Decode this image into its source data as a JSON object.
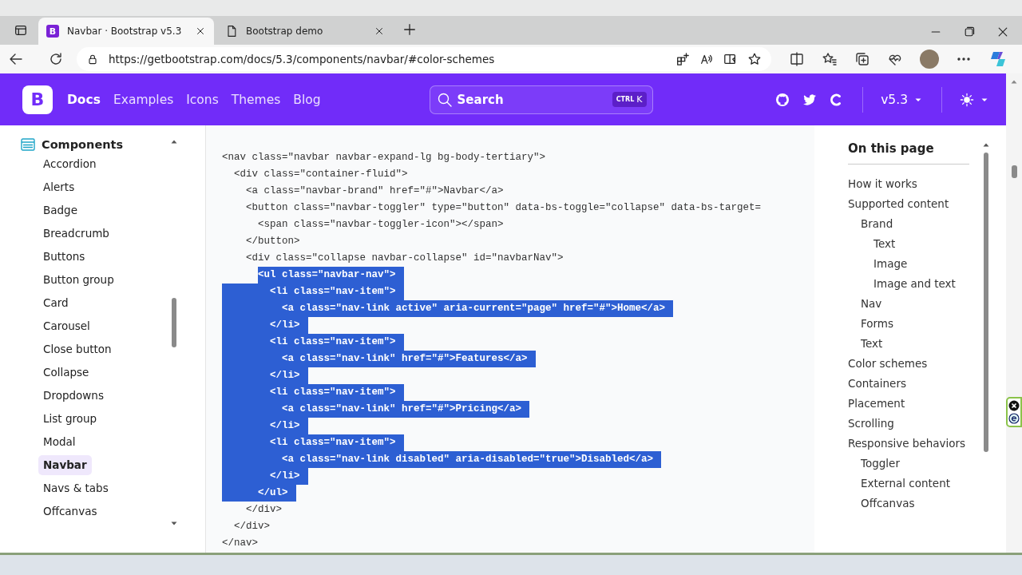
{
  "browser": {
    "tabs": [
      {
        "title": "Navbar · Bootstrap v5.3",
        "selected": true,
        "kind": "bootstrap",
        "favicon_letter": "B"
      },
      {
        "title": "Bootstrap demo",
        "selected": false,
        "kind": "page"
      }
    ],
    "address": "https://getbootstrap.com/docs/5.3/components/navbar/#color-schemes"
  },
  "navbar": {
    "logo": "B",
    "links": [
      {
        "label": "Docs",
        "selected": true
      },
      {
        "label": "Examples",
        "selected": false
      },
      {
        "label": "Icons",
        "selected": false
      },
      {
        "label": "Themes",
        "selected": false
      },
      {
        "label": "Blog",
        "selected": false
      }
    ],
    "search": {
      "placeholder": "Search",
      "shortcut_modifier": "CTRL",
      "shortcut_key": "K"
    },
    "version": "v5.3",
    "dark_mode": false
  },
  "sidebar": {
    "section": "Components",
    "expanded": true,
    "items": [
      {
        "label": "Accordion",
        "selected": false
      },
      {
        "label": "Alerts",
        "selected": false
      },
      {
        "label": "Badge",
        "selected": false
      },
      {
        "label": "Breadcrumb",
        "selected": false
      },
      {
        "label": "Buttons",
        "selected": false
      },
      {
        "label": "Button group",
        "selected": false
      },
      {
        "label": "Card",
        "selected": false
      },
      {
        "label": "Carousel",
        "selected": false
      },
      {
        "label": "Close button",
        "selected": false
      },
      {
        "label": "Collapse",
        "selected": false
      },
      {
        "label": "Dropdowns",
        "selected": false
      },
      {
        "label": "List group",
        "selected": false
      },
      {
        "label": "Modal",
        "selected": false
      },
      {
        "label": "Navbar",
        "selected": true
      },
      {
        "label": "Navs & tabs",
        "selected": false
      },
      {
        "label": "Offcanvas",
        "selected": false
      }
    ]
  },
  "code": {
    "lines": [
      {
        "text": "<nav class=\"navbar navbar-expand-lg bg-body-tertiary\">",
        "selected": false
      },
      {
        "text": "  <div class=\"container-fluid\">",
        "selected": false
      },
      {
        "text": "    <a class=\"navbar-brand\" href=\"#\">Navbar</a>",
        "selected": false
      },
      {
        "text": "    <button class=\"navbar-toggler\" type=\"button\" data-bs-toggle=\"collapse\" data-bs-target=",
        "selected": false
      },
      {
        "text": "      <span class=\"navbar-toggler-icon\"></span>",
        "selected": false
      },
      {
        "text": "    </button>",
        "selected": false
      },
      {
        "text": "    <div class=\"collapse navbar-collapse\" id=\"navbarNav\">",
        "selected": false
      },
      {
        "text": "      <ul class=\"navbar-nav\">",
        "selected": true
      },
      {
        "text": "        <li class=\"nav-item\">",
        "selected": true
      },
      {
        "text": "          <a class=\"nav-link active\" aria-current=\"page\" href=\"#\">Home</a>",
        "selected": true
      },
      {
        "text": "        </li>",
        "selected": true
      },
      {
        "text": "        <li class=\"nav-item\">",
        "selected": true
      },
      {
        "text": "          <a class=\"nav-link\" href=\"#\">Features</a>",
        "selected": true
      },
      {
        "text": "        </li>",
        "selected": true
      },
      {
        "text": "        <li class=\"nav-item\">",
        "selected": true
      },
      {
        "text": "          <a class=\"nav-link\" href=\"#\">Pricing</a>",
        "selected": true
      },
      {
        "text": "        </li>",
        "selected": true
      },
      {
        "text": "        <li class=\"nav-item\">",
        "selected": true
      },
      {
        "text": "          <a class=\"nav-link disabled\" aria-disabled=\"true\">Disabled</a>",
        "selected": true
      },
      {
        "text": "        </li>",
        "selected": true
      },
      {
        "text": "      </ul>",
        "selected": true
      },
      {
        "text": "    </div>",
        "selected": false
      },
      {
        "text": "  </div>",
        "selected": false
      },
      {
        "text": "</nav>",
        "selected": false
      }
    ]
  },
  "toc": {
    "title": "On this page",
    "items": [
      {
        "label": "How it works"
      },
      {
        "label": "Supported content",
        "children": [
          {
            "label": "Brand",
            "children": [
              {
                "label": "Text"
              },
              {
                "label": "Image"
              },
              {
                "label": "Image and text"
              }
            ]
          },
          {
            "label": "Nav"
          },
          {
            "label": "Forms"
          },
          {
            "label": "Text"
          }
        ]
      },
      {
        "label": "Color schemes"
      },
      {
        "label": "Containers"
      },
      {
        "label": "Placement"
      },
      {
        "label": "Scrolling"
      },
      {
        "label": "Responsive behaviors",
        "children": [
          {
            "label": "Toggler"
          },
          {
            "label": "External content"
          },
          {
            "label": "Offcanvas"
          }
        ]
      }
    ]
  }
}
